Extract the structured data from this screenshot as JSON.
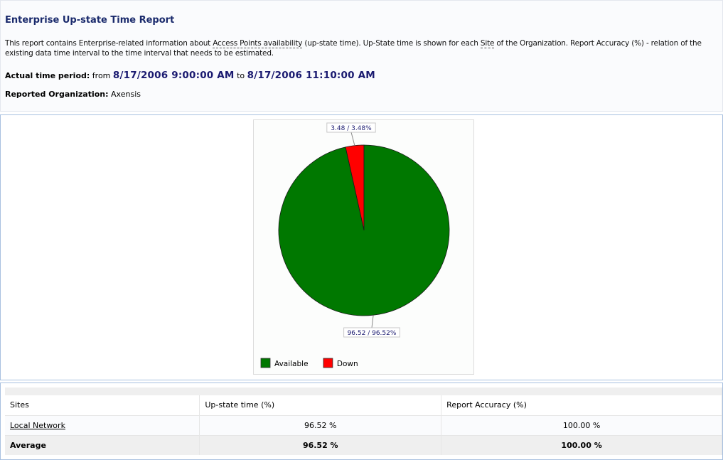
{
  "report": {
    "title": "Enterprise Up-state Time Report",
    "desc_part1": "This report contains Enterprise-related information about ",
    "desc_term1": "Access Points availability",
    "desc_part2": " (up-state time). Up-State time is shown for each ",
    "desc_term2": "Site",
    "desc_part3": " of the Organization. Report Accuracy (%) - relation of the existing data time interval to the time interval that needs to be estimated.",
    "period_label": "Actual time period:",
    "period_from_word": "from",
    "period_from": "8/17/2006 9:00:00 AM",
    "period_to_word": "to",
    "period_to": "8/17/2006 11:10:00 AM",
    "org_label": "Reported Organization:",
    "org_value": "Axensis"
  },
  "chart_data": {
    "type": "pie",
    "slices": [
      {
        "name": "Available",
        "value": 96.52,
        "label": "96.52 / 96.52%",
        "color": "#007800"
      },
      {
        "name": "Down",
        "value": 3.48,
        "label": "3.48 / 3.48%",
        "color": "#ff0000"
      }
    ],
    "legend": "bottom-left"
  },
  "table": {
    "headers": [
      "Sites",
      "Up-state time (%)",
      "Report Accuracy (%)"
    ],
    "rows": [
      {
        "site": "Local Network",
        "uptime": "96.52 %",
        "accuracy": "100.00 %"
      }
    ],
    "average": {
      "label": "Average",
      "uptime": "96.52 %",
      "accuracy": "100.00 %"
    }
  }
}
